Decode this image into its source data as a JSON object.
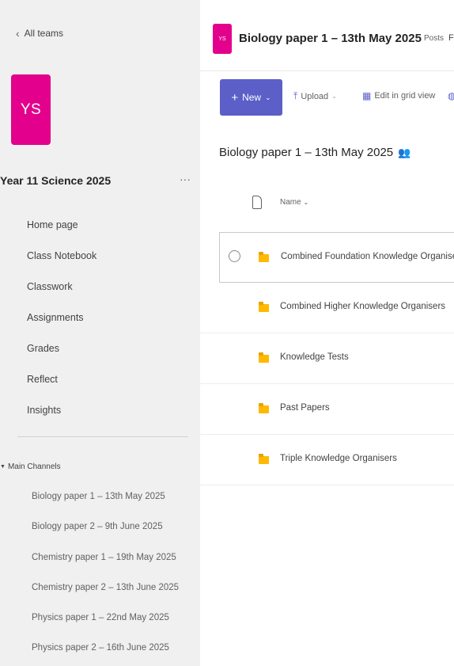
{
  "sidebar": {
    "back_label": "All teams",
    "team_initials": "YS",
    "team_name": "Year 11 Science 2025",
    "more": "···",
    "nav_items": [
      {
        "label": "Home page"
      },
      {
        "label": "Class Notebook"
      },
      {
        "label": "Classwork"
      },
      {
        "label": "Assignments"
      },
      {
        "label": "Grades"
      },
      {
        "label": "Reflect"
      },
      {
        "label": "Insights"
      }
    ],
    "channels_header": "Main Channels",
    "channels": [
      {
        "label": "Biology paper 1 – 13th May 2025"
      },
      {
        "label": "Biology paper 2 – 9th June 2025"
      },
      {
        "label": "Chemistry paper 1 – 19th May 2025"
      },
      {
        "label": "Chemistry paper 2 – 13th June 2025"
      },
      {
        "label": "Physics paper 1 – 22nd May 2025"
      },
      {
        "label": "Physics paper 2 – 16th June 2025"
      }
    ]
  },
  "header": {
    "channel_initials": "YS",
    "title": "Biology paper 1 – 13th May 2025",
    "tab_posts": "Posts",
    "tab_cut": "F"
  },
  "toolbar": {
    "new_label": "New",
    "upload_label": "Upload",
    "grid_label": "Edit in grid view"
  },
  "breadcrumb": "Biology paper 1 – 13th May 2025",
  "list": {
    "name_header": "Name",
    "items": [
      {
        "label": "Combined Foundation Knowledge Organisers"
      },
      {
        "label": "Combined Higher Knowledge Organisers"
      },
      {
        "label": "Knowledge Tests"
      },
      {
        "label": "Past Papers"
      },
      {
        "label": "Triple Knowledge Organisers"
      }
    ]
  },
  "colors": {
    "accent": "#5b5fc7",
    "team_avatar": "#e3008c",
    "folder": "#ffb900"
  }
}
